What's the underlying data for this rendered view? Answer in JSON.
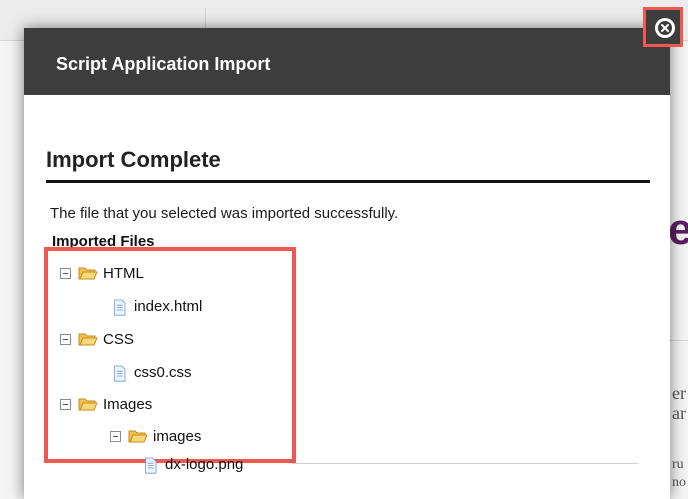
{
  "modal": {
    "title": "Script Application Import"
  },
  "section": {
    "title": "Import Complete",
    "message": "The file that you selected was imported successfully.",
    "files_label": "Imported Files"
  },
  "tree": {
    "html_folder": "HTML",
    "html_file": "index.html",
    "css_folder": "CSS",
    "css_file": "css0.css",
    "images_folder": "Images",
    "images_subfolder": "images",
    "image_file": "dx-logo.png"
  },
  "colors": {
    "header_bg": "#3d3d3d",
    "highlight": "#ef5a50",
    "folder": "#f2c14e",
    "file": "#6a9bd8"
  },
  "icons": {
    "close": "close-circle-icon",
    "folder": "folder-open-icon",
    "file": "file-icon",
    "toggle": "collapse-icon"
  }
}
